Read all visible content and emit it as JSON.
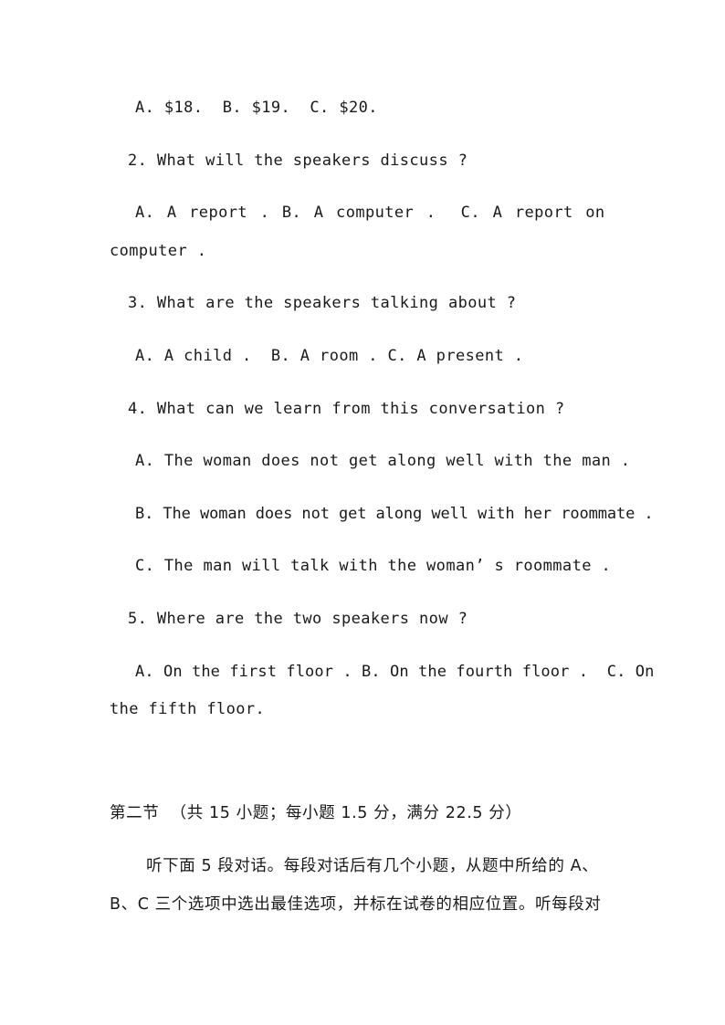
{
  "questions": {
    "q1_options": "A. $18.  B. $19.  C. $20.",
    "q2": {
      "prompt": "2. What will the speakers discuss ?",
      "options_line1": "A. A report . B. A computer .  C. A report on",
      "options_line2": "computer ."
    },
    "q3": {
      "prompt": "3. What are the speakers talking about ?",
      "options": "A. A child .  B. A room . C. A present ."
    },
    "q4": {
      "prompt": "4. What can we learn from this conversation ?",
      "option_a": "A. The woman does not get along well with the man .",
      "option_b": "B. The woman does not get along well with her roommate .",
      "option_c": "C. The man will talk with the woman’ s roommate ."
    },
    "q5": {
      "prompt": "5. Where are the two speakers now ?",
      "options_line1": "A. On the first floor . B. On the fourth floor .  C. On",
      "options_line2": "the fifth floor."
    }
  },
  "section2": {
    "heading": "第二节  （共 15 小题；每小题 1.5 分，满分 22.5 分）",
    "instructions_line1": "听下面 5 段对话。每段对话后有几个小题，从题中所给的 A、",
    "instructions_line2": "B、C 三个选项中选出最佳选项，并标在试卷的相应位置。听每段对"
  }
}
